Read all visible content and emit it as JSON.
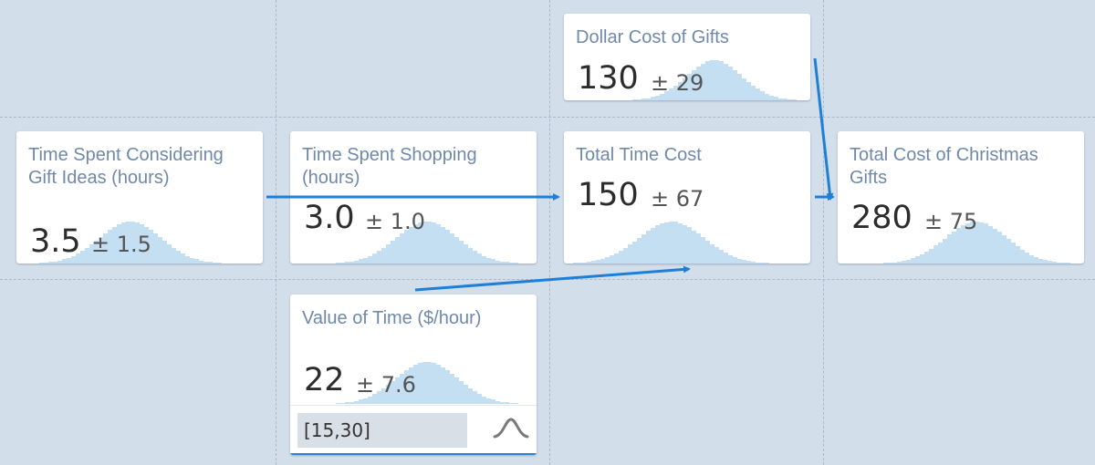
{
  "colors": {
    "background": "#d3deeb",
    "card": "#ffffff",
    "title": "#6f89ab",
    "histogram": "#c5dff2",
    "arrow": "#1e7fd6"
  },
  "nodes": {
    "time_ideas": {
      "title": "Time Spent Considering Gift Ideas (hours)",
      "mean": "3.5",
      "sd": "± 1.5"
    },
    "time_shopping": {
      "title": "Time Spent Shopping (hours)",
      "mean": "3.0",
      "sd": "± 1.0"
    },
    "dollar_cost": {
      "title": "Dollar Cost of Gifts",
      "mean": "130",
      "sd": "± 29"
    },
    "time_cost": {
      "title": "Total Time Cost",
      "mean": "150",
      "sd": "± 67"
    },
    "total_cost": {
      "title": "Total Cost of Christmas Gifts",
      "mean": "280",
      "sd": "± 75"
    },
    "value_time": {
      "title": "Value of Time ($/hour)",
      "mean": "22",
      "sd": "± 7.6",
      "editor_value": "[15,30]",
      "editor_icon": "normal-distribution-icon"
    }
  }
}
